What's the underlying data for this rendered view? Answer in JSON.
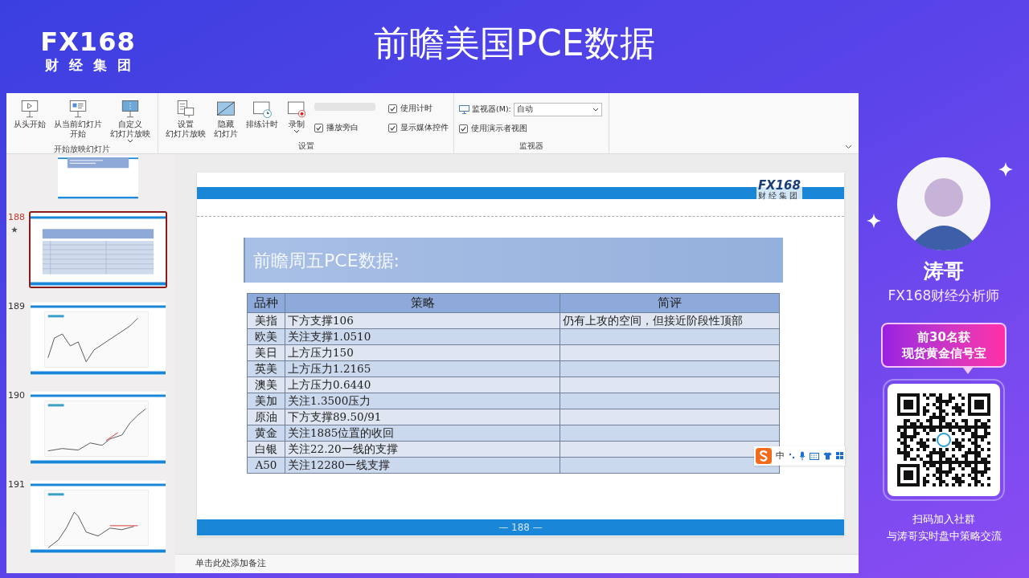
{
  "header": {
    "logo": {
      "brand": "FX168",
      "subtitle": "财经集团"
    },
    "title": "前瞻美国PCE数据"
  },
  "ribbon": {
    "groups": [
      {
        "label": "开始放映幻灯片",
        "buttons": [
          {
            "lines": [
              "从头开始"
            ],
            "has_menu": false
          },
          {
            "lines": [
              "从当前幻灯片",
              "开始"
            ],
            "has_menu": false
          },
          {
            "lines": [
              "自定义",
              "幻灯片放映"
            ],
            "has_menu": true
          }
        ]
      },
      {
        "label": "设置",
        "buttons": [
          {
            "lines": [
              "设置",
              "幻灯片放映"
            ],
            "has_menu": false
          },
          {
            "lines": [
              "隐藏",
              "幻灯片"
            ],
            "has_menu": false
          },
          {
            "lines": [
              "排练计时"
            ],
            "has_menu": false
          },
          {
            "lines": [
              "录制"
            ],
            "has_menu": true
          }
        ],
        "checkboxes": [
          {
            "label": "播放旁白",
            "checked": true
          },
          {
            "label": "使用计时",
            "checked": true
          },
          {
            "label": "显示媒体控件",
            "checked": true
          }
        ]
      },
      {
        "label": "监视器",
        "monitor": {
          "label": "监视器(M):",
          "value": "自动"
        },
        "checkboxes": [
          {
            "label": "使用演示者视图",
            "checked": true
          }
        ]
      }
    ]
  },
  "slides": [
    {
      "kind": "text",
      "selected": false,
      "starred": false
    },
    {
      "number": "188",
      "kind": "table",
      "selected": true,
      "starred": true
    },
    {
      "number": "189",
      "kind": "chart",
      "selected": false,
      "starred": false
    },
    {
      "number": "190",
      "kind": "chart",
      "selected": false,
      "starred": false
    },
    {
      "number": "191",
      "kind": "chart",
      "selected": false,
      "starred": false
    }
  ],
  "slide": {
    "logo": {
      "brand": "FX168",
      "subtitle": "财经集团"
    },
    "title": "前瞻周五PCE数据:",
    "table": {
      "columns": [
        "品种",
        "策略",
        "简评"
      ],
      "rows": [
        {
          "cells": [
            "美指",
            "下方支撑106",
            "仍有上攻的空间，但接近阶段性顶部"
          ]
        },
        {
          "cells": [
            "欧美",
            "关注支撑1.0510"
          ]
        },
        {
          "cells": [
            "美日",
            "上方压力150"
          ]
        },
        {
          "cells": [
            "英美",
            "上方压力1.2165"
          ]
        },
        {
          "cells": [
            "澳美",
            "上方压力0.6440"
          ]
        },
        {
          "cells": [
            "美加",
            "关注1.3500压力"
          ]
        },
        {
          "cells": [
            "原油",
            "下方支撑89.50/91"
          ]
        },
        {
          "cells": [
            "黄金",
            "关注1885位置的收回"
          ]
        },
        {
          "cells": [
            "白银",
            "关注22.20一线的支撑"
          ]
        },
        {
          "cells": [
            "A50",
            "关注12280一线支撑"
          ]
        }
      ]
    },
    "page_number": "— 188 —"
  },
  "ime_toolbar": {
    "mode": "中"
  },
  "notes_placeholder": "单击此处添加备注",
  "host": {
    "name": "涛哥",
    "title": "FX168财经分析师"
  },
  "promo": {
    "lines": [
      "前30名获",
      "现货黄金信号宝"
    ]
  },
  "qr_caption": [
    "扫码加入社群",
    "与涛哥实时盘中策略交流"
  ]
}
